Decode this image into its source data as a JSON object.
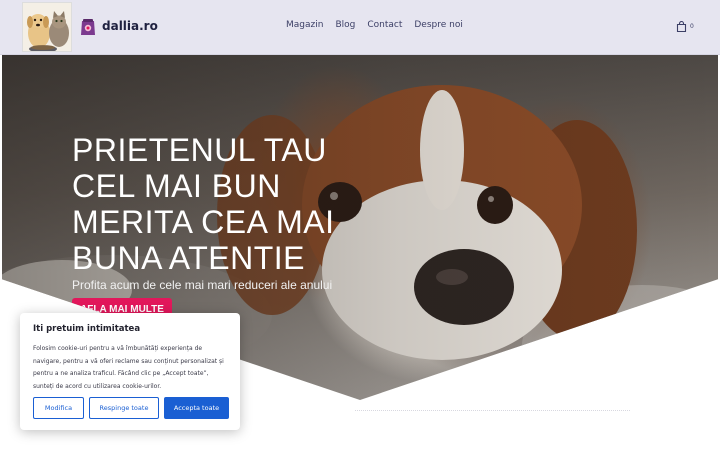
{
  "header": {
    "brand": "dallia.ro",
    "nav": [
      "Magazin",
      "Blog",
      "Contact",
      "Despre noi"
    ],
    "cart_count": "0"
  },
  "hero": {
    "title": "PRIETENUL TAU CEL MAI BUN MERITA CEA MAI BUNA ATENTIE",
    "subtitle": "Profita acum de cele mai mari reduceri ale anului",
    "cta": "AFLA MAI MULTE"
  },
  "cookie": {
    "title": "Iti pretuim intimitatea",
    "text": "Folosim cookie-uri pentru a vă îmbunătăți experiența de navigare, pentru a vă oferi reclame sau conținut personalizat și pentru a ne analiza traficul. Făcând clic pe „Accept toate”, sunteți de acord cu utilizarea cookie-urilor.",
    "buttons": {
      "customize": "Modifica",
      "reject": "Respinge toate",
      "accept": "Accepta toate"
    }
  },
  "icons": {
    "brand": "pet-food-bag-icon",
    "cart": "shopping-bag-icon"
  },
  "colors": {
    "header_bg": "#e6e5f0",
    "cta": "#e2175b",
    "cookie_accent": "#1a5fd3"
  }
}
